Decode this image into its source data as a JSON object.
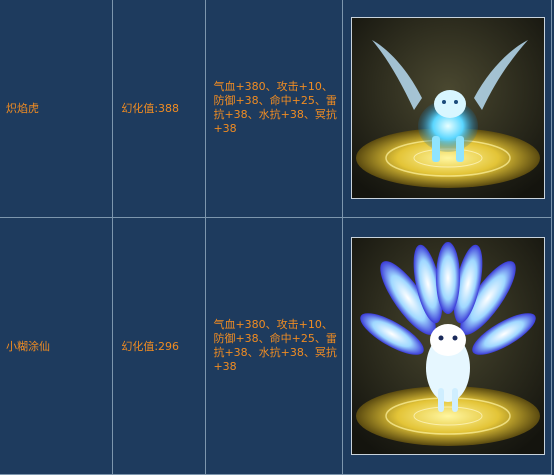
{
  "rows": [
    {
      "name": "炽焰虎",
      "value_label": "幻化值:388",
      "attributes": "气血+380、攻击+10、防御+38、命中+25、雷抗+38、水抗+38、冥抗+38",
      "image_icon": "winged-ice-tiger-icon"
    },
    {
      "name": "小糊涂仙",
      "value_label": "幻化值:296",
      "attributes": "气血+380、攻击+10、防御+38、命中+25、雷抗+38、水抗+38、冥抗+38",
      "image_icon": "nine-tailed-fox-icon"
    }
  ],
  "colors": {
    "background": "#1e3b5e",
    "border": "#7d96ad",
    "text": "#f08c22",
    "glow": "#5ad6ff",
    "platform": "#e3c437"
  }
}
